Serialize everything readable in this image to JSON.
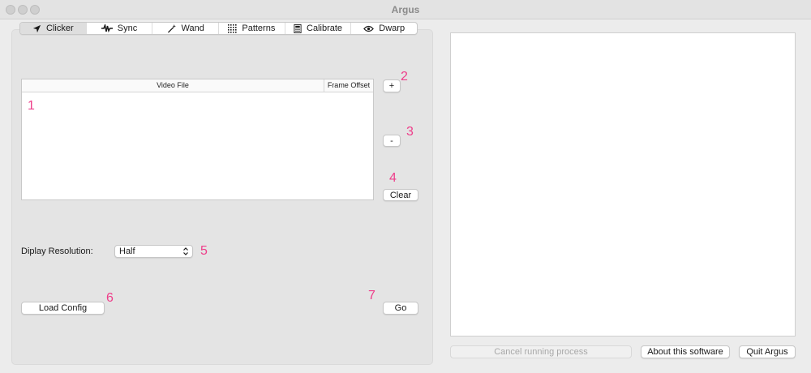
{
  "window": {
    "title": "Argus"
  },
  "tabs": [
    {
      "label": "Clicker",
      "icon": "cursor-arrow-icon",
      "selected": true
    },
    {
      "label": "Sync",
      "icon": "waveform-icon",
      "selected": false
    },
    {
      "label": "Wand",
      "icon": "wand-icon",
      "selected": false
    },
    {
      "label": "Patterns",
      "icon": "dot-grid-icon",
      "selected": false
    },
    {
      "label": "Calibrate",
      "icon": "calculator-icon",
      "selected": false
    },
    {
      "label": "Dwarp",
      "icon": "eye-icon",
      "selected": false
    }
  ],
  "table": {
    "columns": [
      "Video File",
      "Frame Offset"
    ],
    "rows": []
  },
  "buttons": {
    "add": "+",
    "remove": "-",
    "clear": "Clear",
    "load_config": "Load Config",
    "go": "Go",
    "cancel": "Cancel running process",
    "about": "About this software",
    "quit": "Quit Argus"
  },
  "resolution": {
    "label": "Diplay Resolution:",
    "value": "Half"
  },
  "annotations": [
    "1",
    "2",
    "3",
    "4",
    "5",
    "6",
    "7"
  ],
  "colors": {
    "annotation": "#ee3e8a",
    "window_bg": "#ececec"
  }
}
